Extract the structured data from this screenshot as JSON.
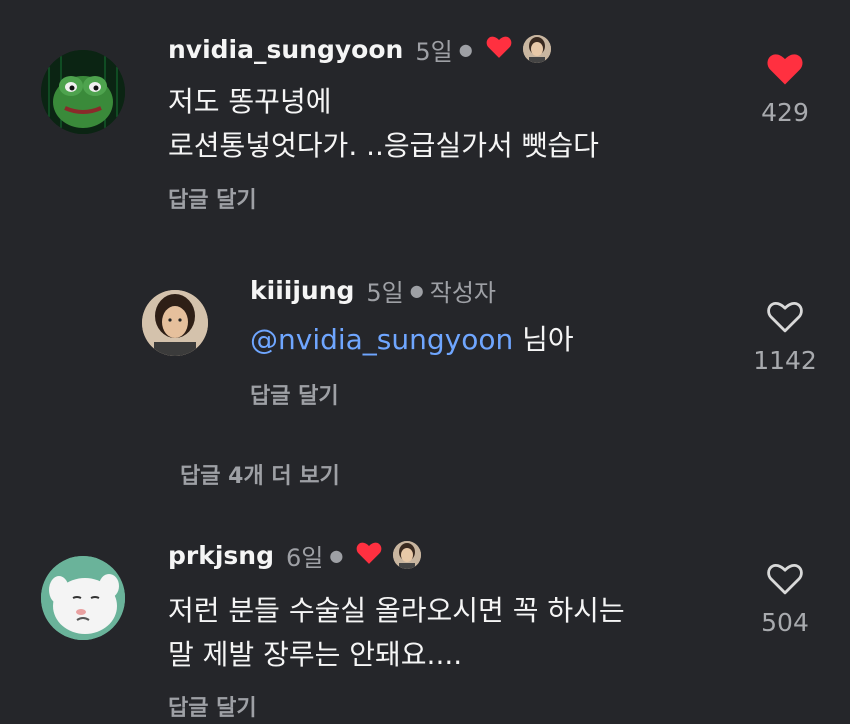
{
  "comments": [
    {
      "username": "nvidia_sungyoon",
      "time": "5일",
      "text_lines": [
        "저도 똥꾸녕에",
        "로션통넣엇다가. ..응급실가서 뺏습다"
      ],
      "reply_label": "답글 달기",
      "likes": "429",
      "liked": true,
      "author_liked": true,
      "avatar": "pepe-frog-avatar"
    },
    {
      "username": "kiiijung",
      "time": "5일",
      "author_tag": "작성자",
      "mention": "@nvidia_sungyoon",
      "text_suffix": " 님아",
      "reply_label": "답글 달기",
      "likes": "1142",
      "liked": false,
      "avatar": "person-avatar"
    },
    {
      "more_replies_label": "답글 4개 더 보기"
    },
    {
      "username": "prkjsng",
      "time": "6일",
      "text_lines": [
        "저런 분들 수술실 올라오시면 꼭 하시는",
        "말 제발 장루는 안돼요...."
      ],
      "reply_label": "답글 달기",
      "likes": "504",
      "liked": false,
      "author_liked": true,
      "avatar": "cartoon-dog-avatar"
    }
  ],
  "colors": {
    "background": "#25262a",
    "heart_red": "#ff3040",
    "mention_blue": "#6fa6ff",
    "muted_text": "#9ea0a5"
  }
}
